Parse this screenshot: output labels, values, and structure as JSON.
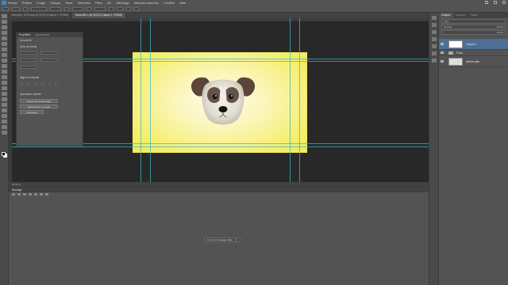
{
  "menubar": {
    "items": [
      "Fichier",
      "Édition",
      "Image",
      "Calque",
      "Texte",
      "Sélection",
      "Filtre",
      "3D",
      "Affichage",
      "Modules externes",
      "Fenêtre",
      "Aide"
    ]
  },
  "document_tabs": [
    {
      "label": "Bannière_DOG.psd @ 33,3% (Calque 1, RVB/8)",
      "active": false
    },
    {
      "label": "Sans titre-1 @ 33,3% (Calque 1, RVB/8)",
      "active": true
    }
  ],
  "properties_panel": {
    "tabs": [
      "Propriétés",
      "Ajustements"
    ],
    "section_title": "Document",
    "canvas_label": "Zone de travail",
    "alignment_label": "Aligner et répartir",
    "quick_actions_label": "Opérations rapides",
    "buttons": [
      "Supprimer l'arrière-plan",
      "Sélectionner un sujet",
      "Découper"
    ]
  },
  "layers_panel": {
    "tabs": [
      "Calques",
      "Couches",
      "Tracés"
    ],
    "filter_placeholder": "Type",
    "blend_mode": "Normal",
    "opacity": "100 %",
    "fill": "100 %",
    "layers": [
      {
        "name": "Calque 1",
        "selected": true
      },
      {
        "name": "Fond",
        "selected": false
      },
      {
        "name": "Arrière-plan",
        "selected": false
      }
    ]
  },
  "timeline": {
    "title": "Montage",
    "create_button": "Créer un montage vidéo"
  },
  "status": {
    "zoom": "33,33 %"
  },
  "colors": {
    "selection": "#4d6f96",
    "guide": "#3bb5c4",
    "canvas_yellow": "#f2ea5a"
  }
}
